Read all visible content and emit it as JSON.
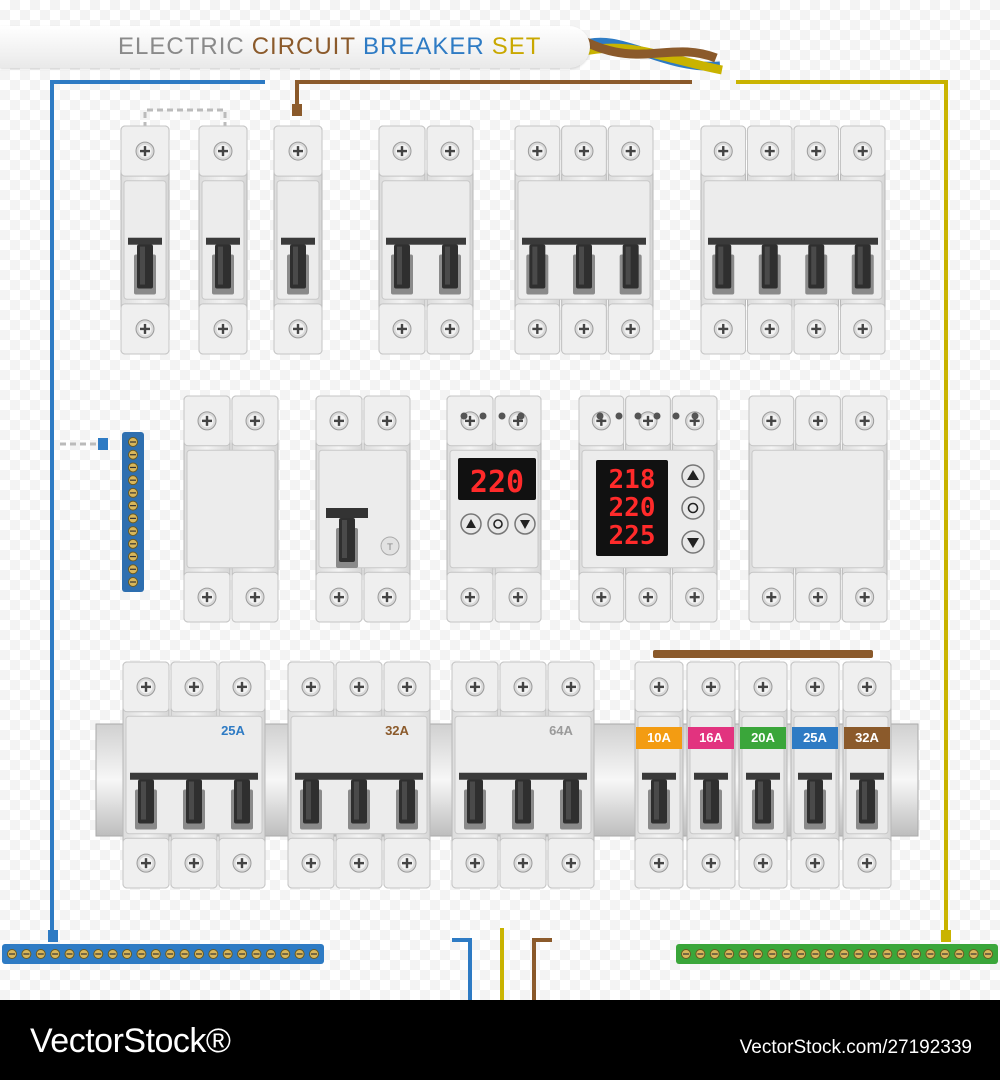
{
  "title": {
    "words": [
      {
        "text": "ELECTRIC",
        "color": "#8a8a8a"
      },
      {
        "text": "CIRCUIT",
        "color": "#8b5a2b"
      },
      {
        "text": "BREAKER",
        "color": "#2e7bc4"
      },
      {
        "text": "SET",
        "color": "#c9a800"
      }
    ]
  },
  "wire_colors": {
    "neutral": "#2e7bc4",
    "phase": "#8b5a2b",
    "ground": "#c9b300"
  },
  "large_breakers": [
    {
      "rating": "25A",
      "color": "#2e7bc4"
    },
    {
      "rating": "32A",
      "color": "#8b5a2b"
    },
    {
      "rating": "64A",
      "color": "#9a9a9a"
    }
  ],
  "small_breakers": [
    {
      "rating": "10A",
      "color": "#f39c12"
    },
    {
      "rating": "16A",
      "color": "#e2337f"
    },
    {
      "rating": "20A",
      "color": "#3aa63a"
    },
    {
      "rating": "25A",
      "color": "#2e7bc4"
    },
    {
      "rating": "32A",
      "color": "#8b5a2b"
    }
  ],
  "voltage_relay_single": {
    "display": "220"
  },
  "voltage_relay_triple": {
    "displays": [
      "218",
      "220",
      "225"
    ]
  },
  "watermark": {
    "brand": "VectorStock®",
    "image_id": "VectorStock.com/27192339"
  }
}
